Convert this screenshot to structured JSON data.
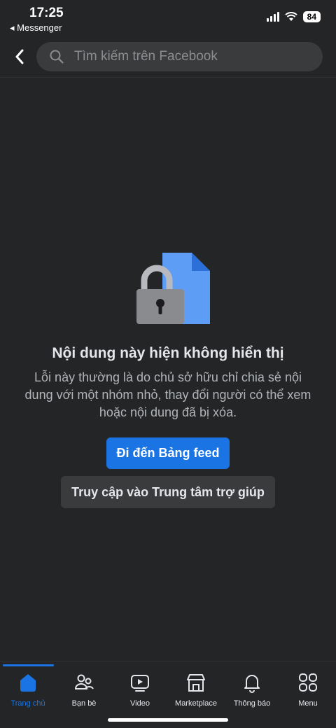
{
  "status_bar": {
    "time": "17:25",
    "back_app": "◂ Messenger",
    "battery": "84"
  },
  "search": {
    "placeholder": "Tìm kiếm trên Facebook"
  },
  "message": {
    "heading": "Nội dung này hiện không hiển thị",
    "description": "Lỗi này thường là do chủ sở hữu chỉ chia sẻ nội dung với một nhóm nhỏ, thay đổi người có thể xem hoặc nội dung đã bị xóa.",
    "primary_button": "Đi đến Bảng feed",
    "secondary_button": "Truy cập vào Trung tâm trợ giúp"
  },
  "tabs": [
    {
      "label": "Trang chủ",
      "icon": "home-icon",
      "active": true
    },
    {
      "label": "Bạn bè",
      "icon": "friends-icon",
      "active": false
    },
    {
      "label": "Video",
      "icon": "video-icon",
      "active": false
    },
    {
      "label": "Marketplace",
      "icon": "marketplace-icon",
      "active": false
    },
    {
      "label": "Thông báo",
      "icon": "bell-icon",
      "active": false
    },
    {
      "label": "Menu",
      "icon": "menu-grid-icon",
      "active": false
    }
  ],
  "colors": {
    "accent": "#1b74e4",
    "background": "#242526",
    "surface": "#3a3b3c"
  }
}
